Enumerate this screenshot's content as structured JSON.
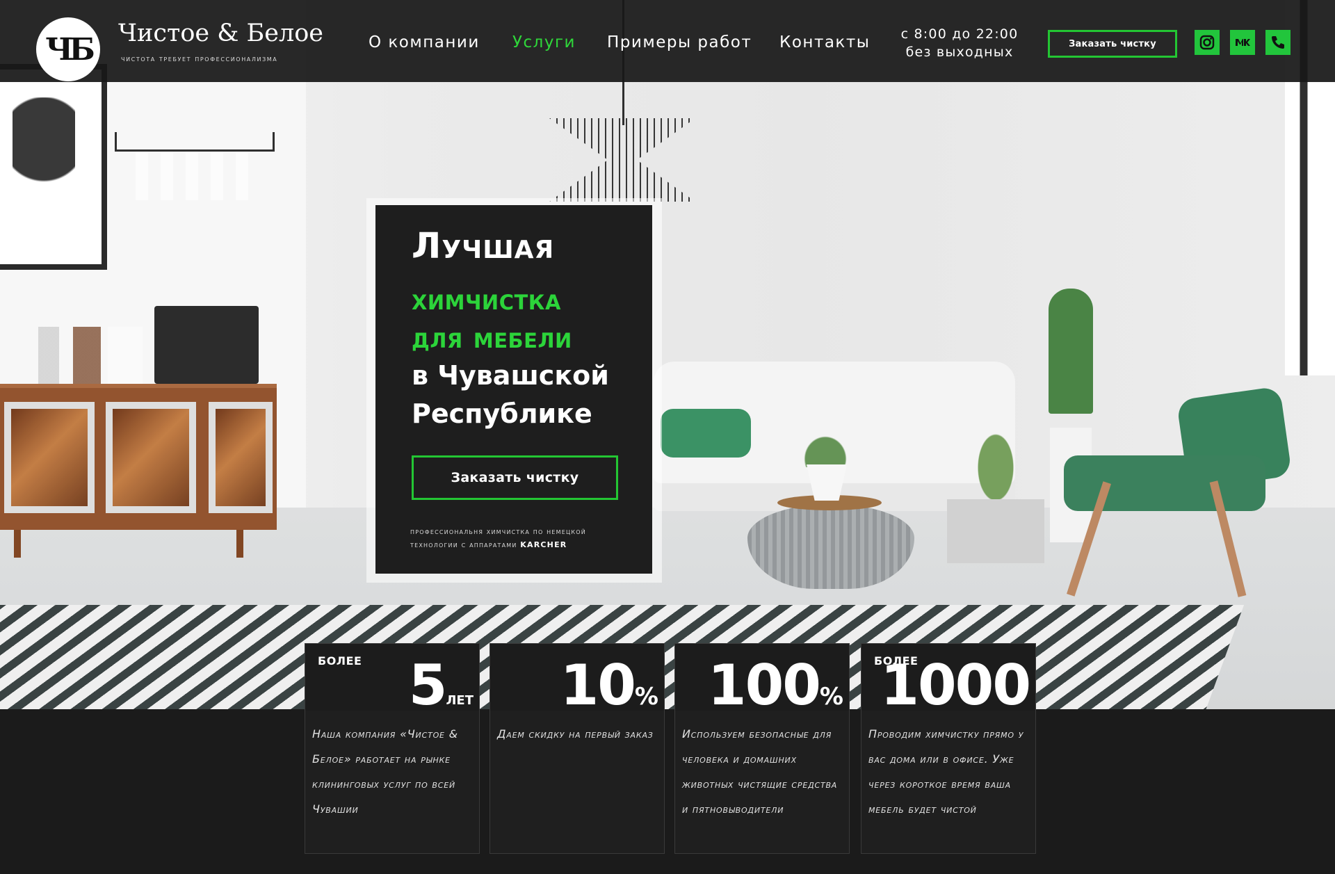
{
  "brand": {
    "logo_letters": "ЧБ",
    "title": "Чистое & Белое",
    "tagline": "чистота требует профессионализма"
  },
  "nav": {
    "items": [
      {
        "label": "О компании",
        "active": false
      },
      {
        "label": "Услуги",
        "active": true
      },
      {
        "label": "Примеры работ",
        "active": false
      },
      {
        "label": "Контакты",
        "active": false
      }
    ]
  },
  "hours": {
    "line1": "с 8:00 до 22:00",
    "line2": "без выходных"
  },
  "header_cta": "Заказать чистку",
  "social": [
    "instagram-icon",
    "vk-icon",
    "phone-icon"
  ],
  "hero": {
    "line1": "Лучшая",
    "line2": "химчистка",
    "line3": "для мебели",
    "line4": "в Чувашской",
    "line5": "Республике",
    "cta": "Заказать чистку",
    "note_line1": "профессиональня химчистка по немецкой",
    "note_line2_prefix": "технологии с аппаратами ",
    "note_brand": "KARCHER"
  },
  "stats": [
    {
      "prefix": "более",
      "value": "5",
      "unit": "лет",
      "text": "Наша компания «Чистое & Белое» работает на рынке клининговых услуг по всей Чувашии"
    },
    {
      "prefix": "",
      "value": "10",
      "unit": "%",
      "text": "Даем скидку на первый заказ"
    },
    {
      "prefix": "",
      "value": "100",
      "unit": "%",
      "text": "Используем безопасные для человека и домашних животных чистящие средства и пятновыводители"
    },
    {
      "prefix": "более",
      "value": "1000",
      "unit": "",
      "text": "Проводим химчистку прямо у вас дома или в офисе. Уже через короткое время ваша мебель будет чистой"
    }
  ],
  "colors": {
    "accent_green": "#2cd43a",
    "dark": "#1b1b1b",
    "header_bg": "#181818"
  }
}
